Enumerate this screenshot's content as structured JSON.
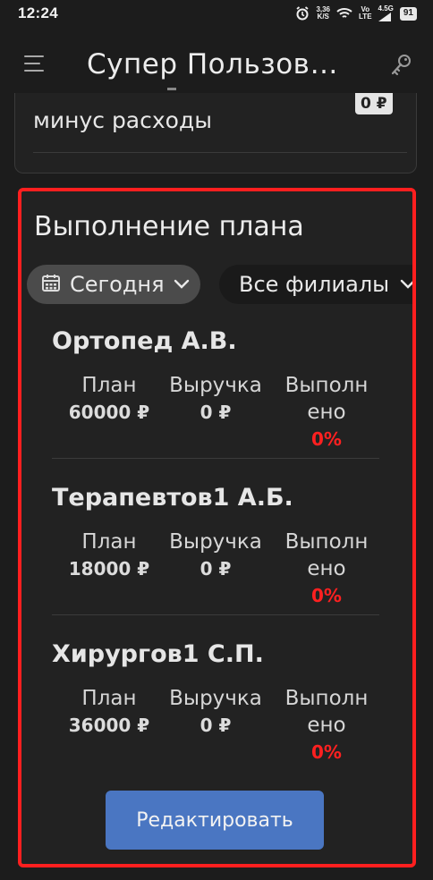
{
  "status_bar": {
    "time": "12:24",
    "net_speed_value": "3,36",
    "net_speed_unit": "K/S",
    "signal_label_top": "Vo",
    "signal_label_bottom": "LTE",
    "network": "4.5G",
    "battery": "91"
  },
  "app_bar": {
    "title": "Супер Пользов…",
    "menu_icon": "menu-icon",
    "key_icon": "key-icon"
  },
  "prev_card": {
    "label": "минус расходы",
    "value": "0 ₽"
  },
  "plan_card": {
    "title": "Выполнение плана",
    "date_filter": "Сегодня",
    "branch_filter": "Все филиалы",
    "col_plan": "План",
    "col_revenue": "Выручка",
    "col_done_1": "Выполн",
    "col_done_2": "ено",
    "doctors": [
      {
        "name": "Ортопед А.В.",
        "plan": "60000 ₽",
        "revenue": "0 ₽",
        "done": "0%"
      },
      {
        "name": "Терапевтов1 А.Б.",
        "plan": "18000 ₽",
        "revenue": "0 ₽",
        "done": "0%"
      },
      {
        "name": "Хирургов1 С.П.",
        "plan": "36000 ₽",
        "revenue": "0 ₽",
        "done": "0%"
      }
    ],
    "edit_button": "Редактировать",
    "highlight_color": "#ff1f1f",
    "accent_color": "#4a76c2",
    "negative_color": "#ff2020"
  }
}
